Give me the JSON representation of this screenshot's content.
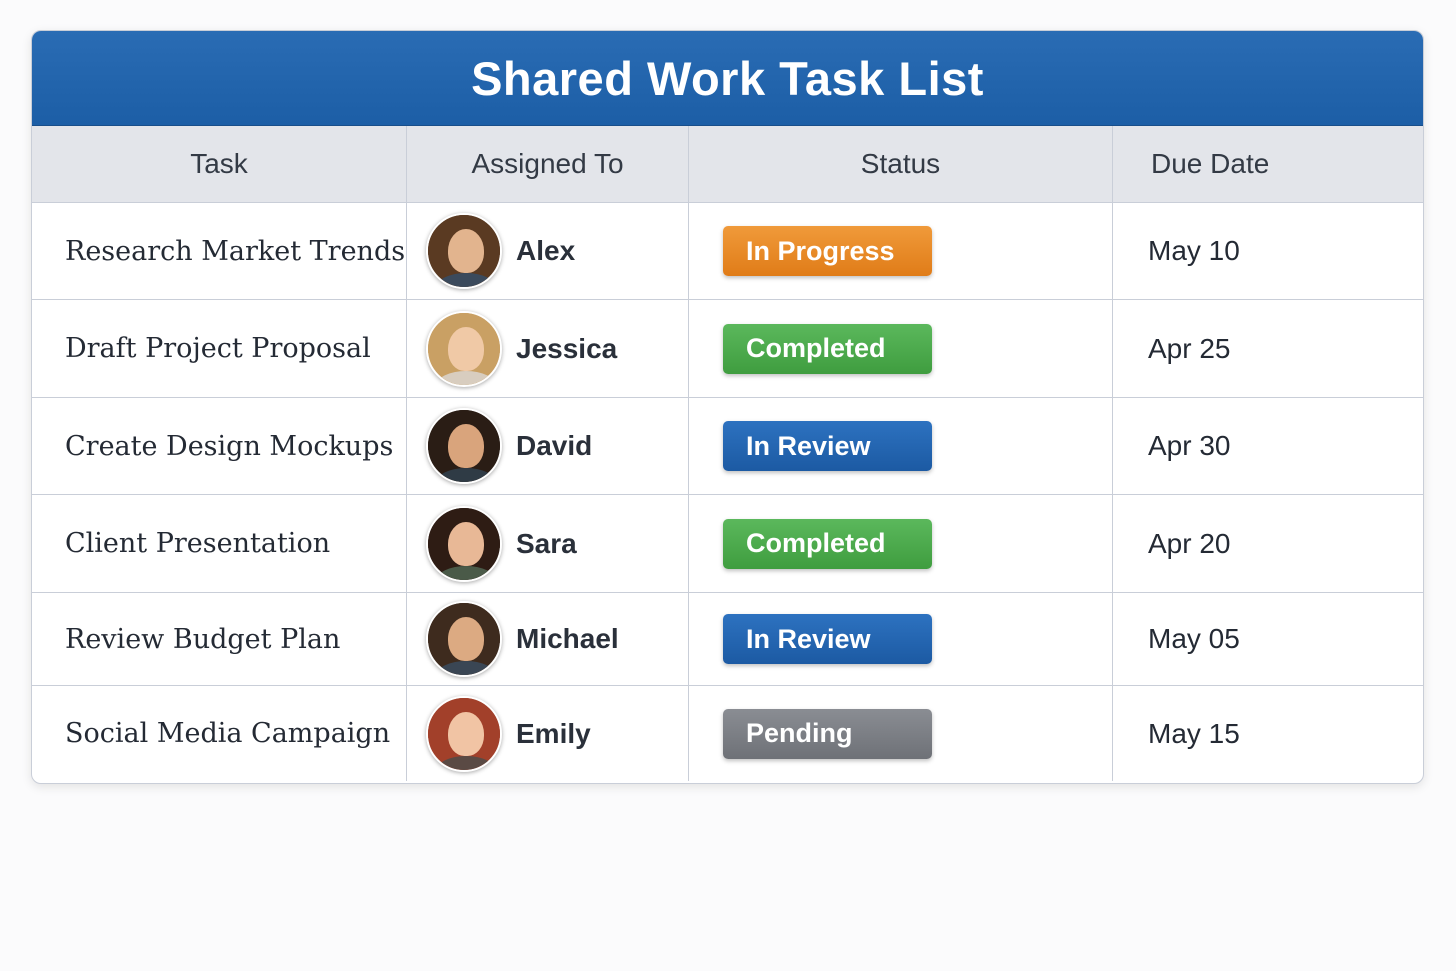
{
  "title": "Shared Work Task List",
  "columns": [
    "Task",
    "Assigned To",
    "Status",
    "Due Date"
  ],
  "status_colors": {
    "In Progress": [
      "#f09a3a",
      "#e07c18"
    ],
    "Completed": [
      "#5bb85c",
      "#3f9d3f"
    ],
    "In Review": [
      "#2d72c0",
      "#1c5aa3"
    ],
    "Pending": [
      "#8a8d93",
      "#6e7177"
    ]
  },
  "rows": [
    {
      "task": "Research Market Trends",
      "assignee": "Alex",
      "status": "In Progress",
      "due": "May 10",
      "avatar": {
        "hair": "#5a3a22",
        "skin": "#e2b48e",
        "shirt": "#3b4a5c"
      }
    },
    {
      "task": "Draft Project Proposal",
      "assignee": "Jessica",
      "status": "Completed",
      "due": "Apr 25",
      "avatar": {
        "hair": "#c9a064",
        "skin": "#f0c9a6",
        "shirt": "#d8cdbf"
      }
    },
    {
      "task": "Create Design Mockups",
      "assignee": "David",
      "status": "In Review",
      "due": "Apr 30",
      "avatar": {
        "hair": "#2a1d15",
        "skin": "#d9a47c",
        "shirt": "#2f3b45"
      }
    },
    {
      "task": "Client Presentation",
      "assignee": "Sara",
      "status": "Completed",
      "due": "Apr 20",
      "avatar": {
        "hair": "#2e1c14",
        "skin": "#e8b896",
        "shirt": "#4a5a48"
      }
    },
    {
      "task": "Review Budget Plan",
      "assignee": "Michael",
      "status": "In Review",
      "due": "May 05",
      "avatar": {
        "hair": "#3e2b1e",
        "skin": "#dcaa82",
        "shirt": "#3a4654"
      }
    },
    {
      "task": "Social Media Campaign",
      "assignee": "Emily",
      "status": "Pending",
      "due": "May 15",
      "avatar": {
        "hair": "#a2402a",
        "skin": "#f1c4a4",
        "shirt": "#5a4a44"
      }
    }
  ]
}
